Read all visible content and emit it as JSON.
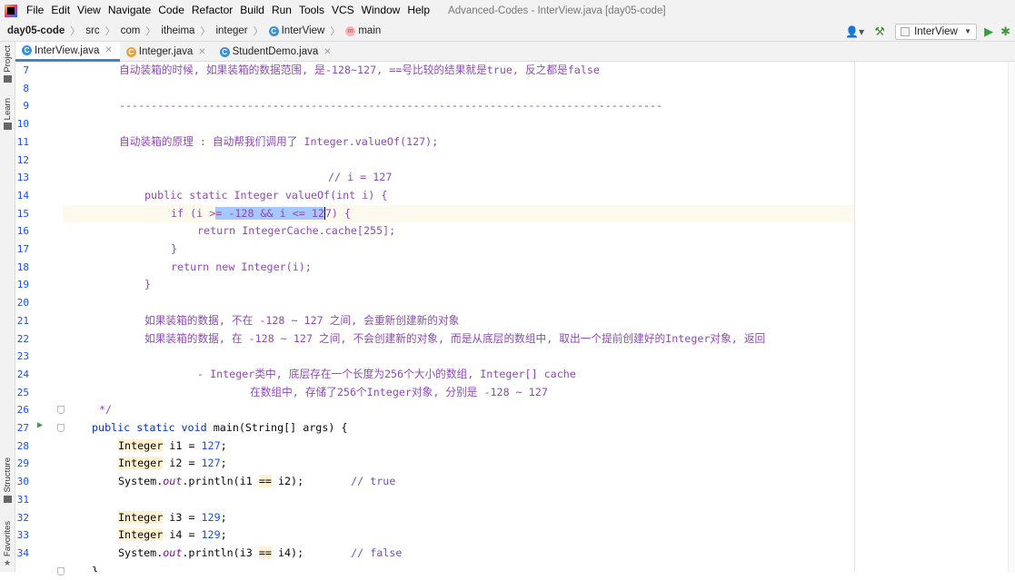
{
  "menubar": {
    "items": [
      "File",
      "Edit",
      "View",
      "Navigate",
      "Code",
      "Refactor",
      "Build",
      "Run",
      "Tools",
      "VCS",
      "Window",
      "Help"
    ],
    "title": "Advanced-Codes - InterView.java [day05-code]"
  },
  "navbar": {
    "crumbs": [
      "day05-code",
      "src",
      "com",
      "itheima",
      "integer",
      "InterView",
      "main"
    ],
    "run_config": "InterView"
  },
  "left_tools": [
    "Project",
    "Learn",
    "Structure",
    "Favorites"
  ],
  "tabs": [
    "InterView.java",
    "Integer.java",
    "StudentDemo.java"
  ],
  "lines": {
    "n7": "7",
    "n8": "8",
    "n9": "9",
    "n10": "10",
    "n11": "11",
    "n12": "12",
    "n13": "13",
    "n14": "14",
    "n15": "15",
    "n16": "16",
    "n17": "17",
    "n18": "18",
    "n19": "19",
    "n20": "20",
    "n21": "21",
    "n22": "22",
    "n23": "23",
    "n24": "24",
    "n25": "25",
    "n26": "26",
    "n27": "27",
    "n28": "28",
    "n29": "29",
    "n30": "30",
    "n31": "31",
    "n32": "32",
    "n33": "33",
    "n34": "34",
    "l7": "自动装箱的时候, 如果装箱的数据范围, 是-128~127, ==号比较的结果就是true, 反之都是false",
    "l9": "-------------------------------------------------------------------------------------",
    "l11": "自动装箱的原理 : 自动帮我们调用了 Integer.valueOf(127);",
    "l13": "// i = 127",
    "l14a": "public static",
    "l14b": " Integer valueOf(",
    "l14c": "int",
    "l14d": " i) {",
    "l15a": "if",
    "l15b": " (i >",
    "l15c": "= -128 && i <= 12",
    "l15d": "7) {",
    "l16a": "return",
    "l16b": " IntegerCache.cache[255];",
    "l17": "}",
    "l18a": "return new",
    "l18b": " Integer(i);",
    "l19": "}",
    "l21": "如果装箱的数据, 不在 -128 ~ 127 之间, 会重新创建新的对象",
    "l22": "如果装箱的数据, 在 -128 ~ 127 之间, 不会创建新的对象, 而是从底层的数组中, 取出一个提前创建好的Integer对象, 返回",
    "l24": "- Integer类中, 底层存在一个长度为256个大小的数组, Integer[] cache",
    "l25": "在数组中, 存储了256个Integer对象, 分别是 -128 ~ 127",
    "l26": "*/",
    "l27a": "public static void",
    "l27b": " main(String[] args) {",
    "l28a": "Integer",
    "l28b": " i1 = ",
    "l28c": "127",
    "l28d": ";",
    "l29a": "Integer",
    "l29b": " i2 = ",
    "l29c": "127",
    "l29d": ";",
    "l30a": "System.",
    "l30b": "out",
    "l30c": ".println(i1 ",
    "l30d": "==",
    "l30e": " i2);",
    "l30f": "// true",
    "l32a": "Integer",
    "l32b": " i3 = ",
    "l32c": "129",
    "l32d": ";",
    "l33a": "Integer",
    "l33b": " i4 = ",
    "l33c": "129",
    "l33d": ";",
    "l34a": "System.",
    "l34b": "out",
    "l34c": ".println(i3 ",
    "l34d": "==",
    "l34e": " i4);",
    "l34f": "// false",
    "l35": "}"
  },
  "icons": {
    "run_gutter": "run-arrow-icon",
    "fold": "fold-marker-icon",
    "build": "hammer-icon",
    "user": "user-icon"
  },
  "colors": {
    "keyword": "#0033b3",
    "comment": "#8c4bb5",
    "number": "#1750eb",
    "selection": "#a6c8ff",
    "tab_accent": "#4083c9",
    "run": "#3c9a3c"
  }
}
